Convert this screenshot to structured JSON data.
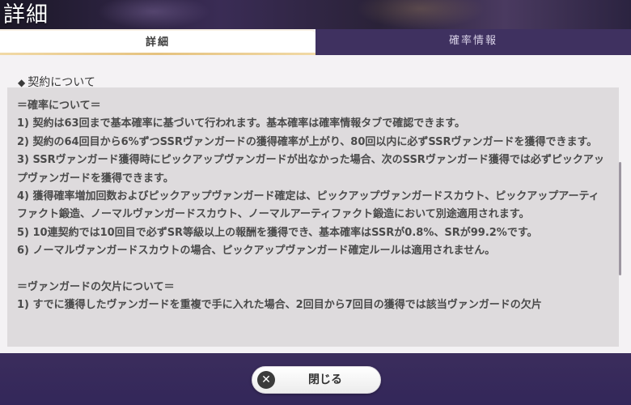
{
  "page_title": "詳細",
  "tabs": [
    {
      "label": "詳細",
      "active": true
    },
    {
      "label": "確率情報",
      "active": false
    }
  ],
  "section": {
    "marker": "◆",
    "title": "契約について"
  },
  "content": {
    "lines": [
      "＝確率について＝",
      "1) 契約は63回まで基本確率に基づいて行われます。基本確率は確率情報タブで確認できます。",
      "2) 契約の64回目から6%ずつSSRヴァンガードの獲得確率が上がり、80回以内に必ずSSRヴァンガードを獲得できます。",
      "3) SSRヴァンガード獲得時にピックアップヴァンガードが出なかった場合、次のSSRヴァンガード獲得では必ずピックアップヴァンガードを獲得できます。",
      "4) 獲得確率増加回数およびピックアップヴァンガード確定は、ピックアップヴァンガードスカウト、ピックアップアーティファクト鍛造、ノーマルヴァンガードスカウト、ノーマルアーティファクト鍛造において別途適用されます。",
      "5) 10連契約では10回目で必ずSR等級以上の報酬を獲得でき、基本確率はSSRが0.8%、SRが99.2%です。",
      "6) ノーマルヴァンガードスカウトの場合、ピックアップヴァンガード確定ルールは適用されません。",
      "",
      "＝ヴァンガードの欠片について＝",
      "1) すでに獲得したヴァンガードを重複で手に入れた場合、2回目から7回目の獲得では該当ヴァンガードの欠片"
    ]
  },
  "close_button": {
    "icon": "✕",
    "label": "閉じる"
  },
  "colors": {
    "tab_active_bg": "#ffffff",
    "tab_inactive_bg": "#3f3160",
    "accent_gold": "#e5c27f",
    "content_bg": "#dedbdd",
    "footer_bg": "#3b2d5c"
  }
}
